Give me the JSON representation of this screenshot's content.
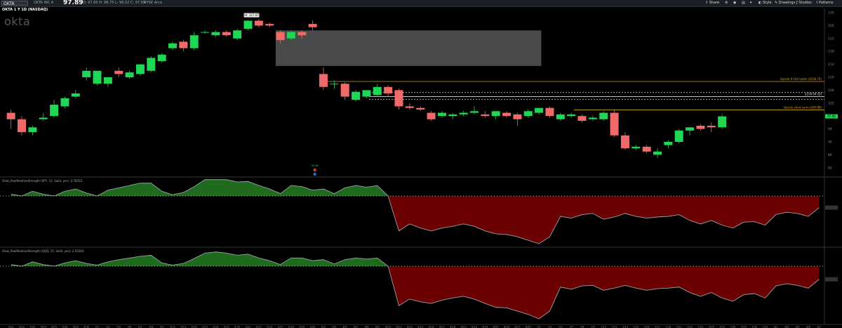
{
  "toolbar": {
    "symbol": "OKTA",
    "company": "OKTA INC A",
    "last": "97.89",
    "ohlc": "O: 97.65   H: 98.75   L: 96.52   C: 97.89",
    "exchange": "NYSE Arca",
    "share_label": "Share",
    "style_label": "Style",
    "drawings_label": "Drawings",
    "studies_label": "Studies",
    "patterns_label": "Patterns"
  },
  "chart_title": "OKTA 1 Y 1D (NASDAQ)",
  "logo_text": "okta",
  "study1_label": "Shak_RealRelativeStrength (SPY, 15, Solid, yes)  -2.78555",
  "study2_label": "Shak_RealRelativeStrength (QQQ, 15, Solid, yes)  -2.50364",
  "annotations": {
    "high": "Hi: 127.67",
    "upside1": "Upside If 104 holds ($108.70)",
    "level104": "$104.04 (D)",
    "upside2": "Upside short term ($99.88)",
    "last_badge": "97.89",
    "event_value": "95.58"
  },
  "colors": {
    "up": "#1fd655",
    "down": "#f06a6a",
    "gold": "#d4a017",
    "gray_box": "#4a4a4a",
    "rs_up": "#1e6b1e",
    "rs_down": "#6b0000"
  },
  "chart_data": {
    "type": "candlestick",
    "ylim": [
      80,
      130
    ],
    "y_ticks": [
      82,
      86,
      90,
      94,
      98,
      102,
      106,
      110,
      114,
      118,
      122,
      126,
      130
    ],
    "x_ticks": [
      "4/21",
      "4/22",
      "4/23",
      "4/24",
      "4/25",
      "4/28",
      "4/29",
      "4/30",
      "5/1",
      "5/2",
      "5/5",
      "5/6",
      "5/7",
      "5/8",
      "5/9",
      "5/12",
      "5/13",
      "5/14",
      "5/15",
      "5/16",
      "5/19",
      "5/20",
      "5/21",
      "5/22",
      "5/23",
      "5/27",
      "5/28",
      "5/29",
      "5/30",
      "6/2",
      "6/3",
      "6/4",
      "6/5",
      "6/6",
      "6/9",
      "6/10",
      "6/11",
      "6/12",
      "6/13",
      "6/16",
      "6/17",
      "6/18",
      "6/20",
      "6/23",
      "6/24",
      "6/25",
      "6/26",
      "6/27",
      "6/30",
      "7/1",
      "7/2",
      "7/3",
      "7/7",
      "7/8",
      "7/9",
      "7/10",
      "7/11",
      "7/14",
      "7/15",
      "7/16",
      "7/17",
      "7/18",
      "7/21",
      "7/22",
      "7/23",
      "7/24",
      "7/25",
      "7/28",
      "7/29",
      "7/30",
      "7/31",
      "8/1",
      "8/4",
      "8/5",
      "8/6",
      "8/7"
    ],
    "candles": [
      {
        "o": 99,
        "h": 100,
        "l": 94,
        "c": 97
      },
      {
        "o": 97,
        "h": 98,
        "l": 92,
        "c": 93
      },
      {
        "o": 93,
        "h": 95,
        "l": 92,
        "c": 94.5
      },
      {
        "o": 97,
        "h": 99,
        "l": 96.5,
        "c": 97.5
      },
      {
        "o": 98,
        "h": 103,
        "l": 97.5,
        "c": 101.5
      },
      {
        "o": 101,
        "h": 104,
        "l": 100.5,
        "c": 103.5
      },
      {
        "o": 104,
        "h": 106,
        "l": 103.5,
        "c": 105
      },
      {
        "o": 110,
        "h": 113,
        "l": 109,
        "c": 112
      },
      {
        "o": 108,
        "h": 112,
        "l": 107.5,
        "c": 112
      },
      {
        "o": 108,
        "h": 110,
        "l": 107,
        "c": 110
      },
      {
        "o": 112,
        "h": 113,
        "l": 110,
        "c": 111
      },
      {
        "o": 110,
        "h": 112,
        "l": 109.5,
        "c": 111.5
      },
      {
        "o": 111,
        "h": 114,
        "l": 110.5,
        "c": 114
      },
      {
        "o": 112,
        "h": 116.5,
        "l": 111.5,
        "c": 116
      },
      {
        "o": 115,
        "h": 117.5,
        "l": 114.5,
        "c": 117
      },
      {
        "o": 119,
        "h": 121,
        "l": 118.5,
        "c": 120.5
      },
      {
        "o": 121,
        "h": 121.5,
        "l": 118,
        "c": 119
      },
      {
        "o": 119,
        "h": 124,
        "l": 118.5,
        "c": 123
      },
      {
        "o": 124,
        "h": 124.5,
        "l": 123.5,
        "c": 124
      },
      {
        "o": 123,
        "h": 124.5,
        "l": 122.5,
        "c": 124
      },
      {
        "o": 124,
        "h": 124.5,
        "l": 122.5,
        "c": 123
      },
      {
        "o": 122,
        "h": 125,
        "l": 121.5,
        "c": 124.5
      },
      {
        "o": 125,
        "h": 127.7,
        "l": 124.5,
        "c": 127.5
      },
      {
        "o": 127.5,
        "h": 128,
        "l": 125.5,
        "c": 126
      },
      {
        "o": 126.5,
        "h": 127,
        "l": 125.5,
        "c": 126
      },
      {
        "o": 124,
        "h": 124.5,
        "l": 120.5,
        "c": 121.5
      },
      {
        "o": 122,
        "h": 124.5,
        "l": 121.5,
        "c": 124
      },
      {
        "o": 124,
        "h": 124.5,
        "l": 122,
        "c": 123
      },
      {
        "o": 126.5,
        "h": 127.5,
        "l": 124.5,
        "c": 125.5
      },
      {
        "o": 111,
        "h": 113,
        "l": 106,
        "c": 107
      },
      {
        "o": 108,
        "h": 109,
        "l": 106.5,
        "c": 108
      },
      {
        "o": 108,
        "h": 108.5,
        "l": 103,
        "c": 104
      },
      {
        "o": 103,
        "h": 106,
        "l": 102.5,
        "c": 105.5
      },
      {
        "o": 104,
        "h": 106,
        "l": 103.5,
        "c": 106
      },
      {
        "o": 104.5,
        "h": 108,
        "l": 104,
        "c": 107
      },
      {
        "o": 107,
        "h": 107.5,
        "l": 104,
        "c": 105
      },
      {
        "o": 106,
        "h": 106.5,
        "l": 100,
        "c": 101
      },
      {
        "o": 101,
        "h": 102,
        "l": 100,
        "c": 100.5
      },
      {
        "o": 100.5,
        "h": 101,
        "l": 99.5,
        "c": 100
      },
      {
        "o": 99,
        "h": 99.5,
        "l": 96.5,
        "c": 97
      },
      {
        "o": 98,
        "h": 99.5,
        "l": 97.5,
        "c": 99
      },
      {
        "o": 98,
        "h": 99,
        "l": 97,
        "c": 98.5
      },
      {
        "o": 98.5,
        "h": 99.5,
        "l": 98,
        "c": 99
      },
      {
        "o": 99,
        "h": 101,
        "l": 98.5,
        "c": 99.5
      },
      {
        "o": 98.5,
        "h": 99.5,
        "l": 97.5,
        "c": 98
      },
      {
        "o": 98,
        "h": 99,
        "l": 97,
        "c": 99.5
      },
      {
        "o": 99,
        "h": 99.5,
        "l": 97.5,
        "c": 98
      },
      {
        "o": 98.5,
        "h": 99,
        "l": 95,
        "c": 97
      },
      {
        "o": 98,
        "h": 100,
        "l": 97.5,
        "c": 99.5
      },
      {
        "o": 99,
        "h": 100.5,
        "l": 98.5,
        "c": 100.5
      },
      {
        "o": 100.5,
        "h": 101,
        "l": 97.5,
        "c": 98
      },
      {
        "o": 97,
        "h": 99,
        "l": 96.5,
        "c": 98.5
      },
      {
        "o": 98,
        "h": 99,
        "l": 97.5,
        "c": 98.5
      },
      {
        "o": 98,
        "h": 98.5,
        "l": 96,
        "c": 96.5
      },
      {
        "o": 97,
        "h": 98,
        "l": 96.5,
        "c": 97.5
      },
      {
        "o": 97,
        "h": 99.5,
        "l": 96.5,
        "c": 99
      },
      {
        "o": 99,
        "h": 100,
        "l": 91.5,
        "c": 92
      },
      {
        "o": 92,
        "h": 93,
        "l": 87.5,
        "c": 88
      },
      {
        "o": 88,
        "h": 89,
        "l": 87.5,
        "c": 88.5
      },
      {
        "o": 88.5,
        "h": 89,
        "l": 86.5,
        "c": 87
      },
      {
        "o": 86,
        "h": 88,
        "l": 85,
        "c": 87
      },
      {
        "o": 89,
        "h": 90.5,
        "l": 88,
        "c": 90
      },
      {
        "o": 90,
        "h": 94,
        "l": 89.5,
        "c": 93.5
      },
      {
        "o": 93.5,
        "h": 94.5,
        "l": 92,
        "c": 94.5
      },
      {
        "o": 95,
        "h": 95.5,
        "l": 93.5,
        "c": 94
      },
      {
        "o": 95,
        "h": 96,
        "l": 93,
        "c": 94.5
      },
      {
        "o": 94.5,
        "h": 98.5,
        "l": 94,
        "c": 97.9
      }
    ],
    "gray_zone": {
      "from": "5/27",
      "to": "7/1",
      "y_low": 113.5,
      "y_high": 124.5
    },
    "levels": [
      {
        "value": 108.7,
        "from": "6/3",
        "label": "Upside If 104 holds ($108.70)"
      },
      {
        "value": 104.04,
        "from": "6/9",
        "label": "$104.04 (D)"
      },
      {
        "value": 99.88,
        "from": "7/8",
        "label": "Upside short term ($99.88)"
      }
    ],
    "rs_spy": [
      0.3,
      0.0,
      0.8,
      0.3,
      0.0,
      0.8,
      1.2,
      0.5,
      0.0,
      1.0,
      1.4,
      1.8,
      2.2,
      2.2,
      0.8,
      0.2,
      0.6,
      1.6,
      2.8,
      2.8,
      2.8,
      2.4,
      2.5,
      1.8,
      1.2,
      0.4,
      1.8,
      1.6,
      1.0,
      1.2,
      0.4,
      1.4,
      1.8,
      1.5,
      1.8,
      0.0,
      -6.0,
      -4.8,
      -5.5,
      -6.0,
      -5.5,
      -5.2,
      -4.8,
      -5.2,
      -6.0,
      -6.5,
      -6.6,
      -7.0,
      -7.6,
      -8.2,
      -7.0,
      -3.5,
      -3.8,
      -3.2,
      -3.0,
      -4.0,
      -3.6,
      -3.0,
      -3.5,
      -3.8,
      -3.6,
      -3.5,
      -3.2,
      -4.2,
      -4.8,
      -4.2,
      -5.0,
      -5.5,
      -4.5,
      -4.4,
      -5.0,
      -3.2,
      -2.8,
      -3.0,
      -3.5,
      -2.0
    ],
    "rs_qqq": [
      0.3,
      0.0,
      0.8,
      0.3,
      0.0,
      0.6,
      1.0,
      0.5,
      0.2,
      0.8,
      1.2,
      1.5,
      1.8,
      2.0,
      0.6,
      0.2,
      0.5,
      1.4,
      2.4,
      2.6,
      2.4,
      2.0,
      2.2,
      1.5,
      1.0,
      0.3,
      1.5,
      1.5,
      1.0,
      1.2,
      0.4,
      1.2,
      1.5,
      1.3,
      1.5,
      0.0,
      -7.2,
      -6.0,
      -6.5,
      -6.8,
      -6.2,
      -5.8,
      -5.5,
      -6.0,
      -6.8,
      -7.5,
      -7.6,
      -8.2,
      -8.8,
      -9.6,
      -8.2,
      -3.8,
      -4.2,
      -3.6,
      -3.5,
      -4.4,
      -4.0,
      -3.5,
      -4.0,
      -4.4,
      -4.1,
      -4.0,
      -3.8,
      -4.8,
      -5.5,
      -4.8,
      -5.8,
      -6.4,
      -5.2,
      -5.0,
      -5.8,
      -3.6,
      -3.2,
      -3.5,
      -4.0,
      -2.4
    ]
  }
}
